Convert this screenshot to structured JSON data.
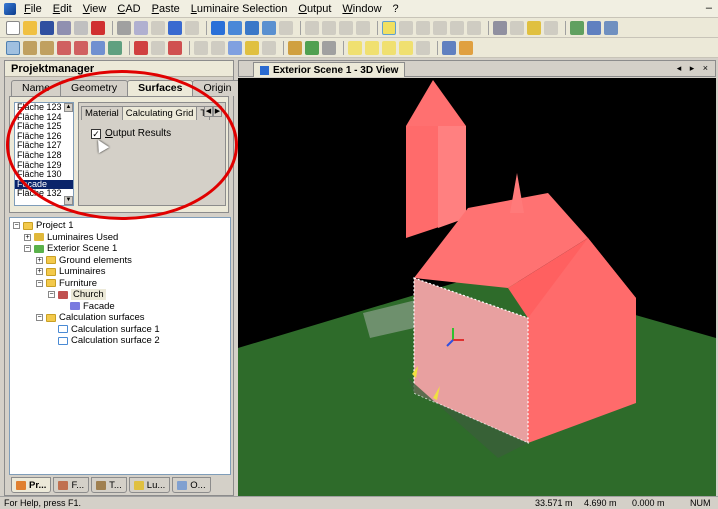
{
  "menu": {
    "items": [
      "File",
      "Edit",
      "View",
      "CAD",
      "Paste",
      "Luminaire Selection",
      "Output",
      "Window",
      "?"
    ]
  },
  "project_manager": {
    "title": "Projektmanager",
    "tabs": [
      "Name",
      "Geometry",
      "Surfaces",
      "Origin"
    ],
    "active_tab": "Surfaces",
    "surface_list": [
      "Fläche 123",
      "Fläche 124",
      "Fläche 125",
      "Fläche 126",
      "Fläche 127",
      "Fläche 128",
      "Fläche 129",
      "Fläche 130",
      "Facade",
      "Fläche 132"
    ],
    "selected_surface": "Facade",
    "inner_tabs": [
      "Material",
      "Calculating Grid",
      "T"
    ],
    "output_results_label": "Output Results",
    "output_results_checked": "✓"
  },
  "tree": {
    "project": "Project 1",
    "luminaires_used": "Luminaires Used",
    "exterior_scene": "Exterior Scene 1",
    "ground_elements": "Ground elements",
    "luminaires": "Luminaires",
    "furniture": "Furniture",
    "church": "Church",
    "facade": "Facade",
    "calc_surfaces": "Calculation surfaces",
    "calc_surface_1": "Calculation surface 1",
    "calc_surface_2": "Calculation surface 2"
  },
  "bottom_tabs": [
    "Pr...",
    "F...",
    "T...",
    "Lu...",
    "O..."
  ],
  "view": {
    "tab_title": "Exterior Scene 1 - 3D View",
    "controls": "◂ ▸ ×"
  },
  "status": {
    "help": "For Help, press F1.",
    "x": "33.571 m",
    "y": "4.690 m",
    "z": "0.000 m",
    "num": "NUM"
  },
  "colors": {
    "church": "#ff6b6b",
    "ground": "#2e6b2a",
    "background": "#000000",
    "highlight": "#e00000"
  }
}
